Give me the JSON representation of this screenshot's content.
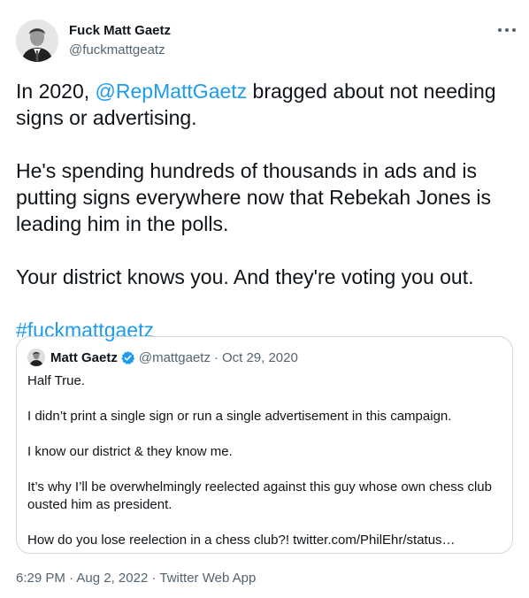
{
  "author": {
    "name": "Fuck Matt Gaetz",
    "handle": "@fuckmattgeatz"
  },
  "tweet": {
    "line1_prefix": "In 2020, ",
    "mention": "@RepMattGaetz",
    "line1_suffix": " bragged about not needing signs or advertising.",
    "para2": "He's spending hundreds of thousands in ads and is putting signs everywhere now that Rebekah Jones is leading him in the polls.",
    "para3": "Your district knows you. And they're voting you out.",
    "hashtag": "#fuckmattgaetz"
  },
  "quote": {
    "name": "Matt Gaetz",
    "handle": "@mattgaetz",
    "separator": "·",
    "date": "Oct 29, 2020",
    "paragraphs": [
      "Half True.",
      "I didn’t print a single sign or run a single advertisement in this campaign.",
      "I know our district & they know me.",
      "It’s why I’ll be overwhelmingly reelected against this guy whose own chess club ousted him as president.",
      "How do you lose reelection in a chess club?! twitter.com/PhilEhr/status…"
    ]
  },
  "footer": {
    "time": "6:29 PM",
    "separator": "·",
    "date": "Aug 2, 2022",
    "source": "Twitter Web App"
  },
  "icons": {
    "more": "more-icon",
    "verified": "verified-badge-icon",
    "avatar": "avatar"
  },
  "colors": {
    "link": "#1d9bf0",
    "secondary_text": "#536471",
    "border": "#cfd9de",
    "verified": "#1d9bf0"
  }
}
